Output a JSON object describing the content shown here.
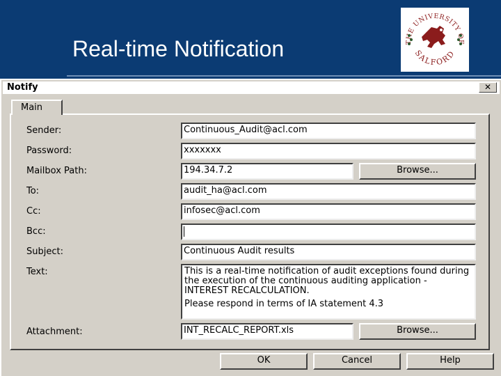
{
  "slide": {
    "title": "Real-time Notification",
    "logo": {
      "text_top": "THE UNIVERSITY OF",
      "text_bottom": "SALFORD",
      "color": "#8b1c1c"
    }
  },
  "dialog": {
    "title": "Notify",
    "close_label": "✕",
    "tab_label": "Main",
    "labels": {
      "sender": "Sender:",
      "password": "Password:",
      "mailbox": "Mailbox Path:",
      "to": "To:",
      "cc": "Cc:",
      "bcc": "Bcc:",
      "subject": "Subject:",
      "text": "Text:",
      "attachment": "Attachment:"
    },
    "values": {
      "sender": "Continuous_Audit@acl.com",
      "password": "xxxxxxx",
      "mailbox": "194.34.7.2",
      "to": "audit_ha@acl.com",
      "cc": "infosec@acl.com",
      "bcc": "",
      "subject": "Continuous Audit results",
      "text_line1": "This is a real-time notification of audit exceptions found during the execution of the continuous auditing application - INTEREST RECALCULATION.",
      "text_line2": "Please respond in terms of IA statement 4.3",
      "attachment": "INT_RECALC_REPORT.xls"
    },
    "buttons": {
      "browse_mailbox": "Browse...",
      "browse_attachment": "Browse...",
      "ok": "OK",
      "cancel": "Cancel",
      "help": "Help"
    }
  }
}
